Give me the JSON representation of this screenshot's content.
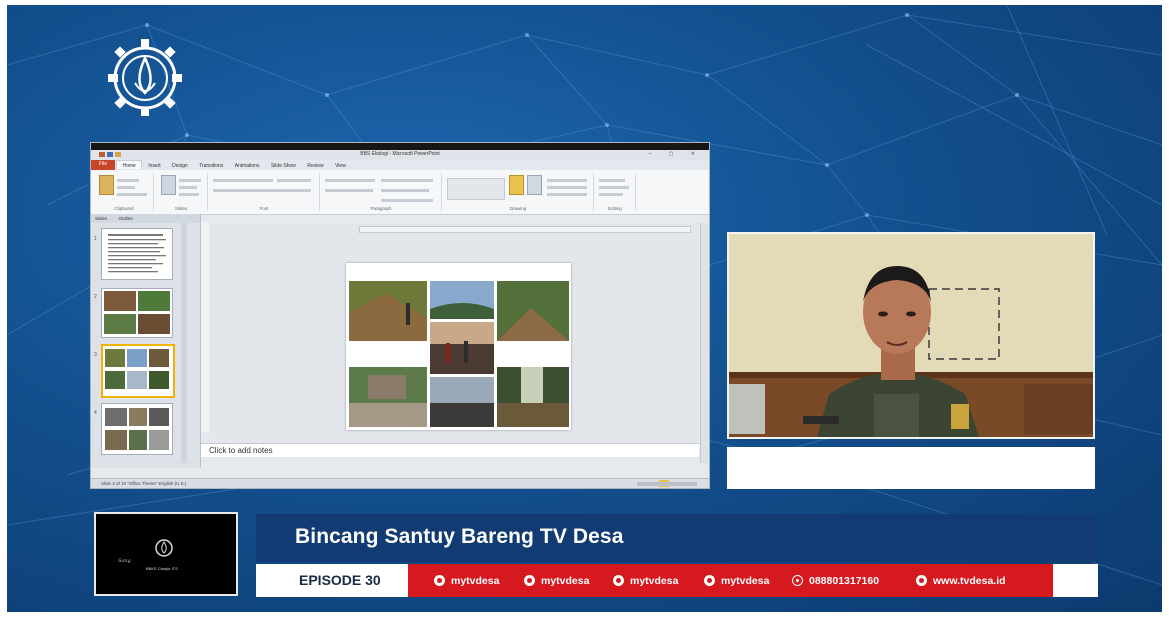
{
  "app": {
    "window_title": "BBS Ekologi - Microsoft PowerPoint",
    "ribbon_tabs": [
      "File",
      "Home",
      "Insert",
      "Design",
      "Transitions",
      "Animations",
      "Slide Show",
      "Review",
      "View"
    ],
    "ribbon_groups": [
      "Clipboard",
      "Slides",
      "Font",
      "Paragraph",
      "Drawing",
      "Editing"
    ],
    "pane_tabs": [
      "Slides",
      "Outline"
    ],
    "slide_numbers": [
      "1",
      "2",
      "3",
      "4"
    ],
    "notes_placeholder": "Click to add notes",
    "status_text": "Slide 3 of 15   \"Office Theme\"   English (U.S.)"
  },
  "broadcast": {
    "title": "Bincang Santuy Bareng TV Desa",
    "episode": "EPISODE 30",
    "socials": [
      {
        "icon": "facebook-icon",
        "label": "mytvdesa"
      },
      {
        "icon": "instagram-icon",
        "label": "mytvdesa"
      },
      {
        "icon": "twitter-icon",
        "label": "mytvdesa"
      },
      {
        "icon": "youtube-icon",
        "label": "mytvdesa"
      },
      {
        "icon": "whatsapp-icon",
        "label": "088801317160"
      },
      {
        "icon": "web-icon",
        "label": "www.tvdesa.id"
      }
    ],
    "thumb_caption": "BBKS Cianjur ITS"
  },
  "colors": {
    "background": "#13508f",
    "lower_third_bar": "#123a73",
    "social_bar": "#d6181f",
    "selected_slide": "#f0b400"
  }
}
